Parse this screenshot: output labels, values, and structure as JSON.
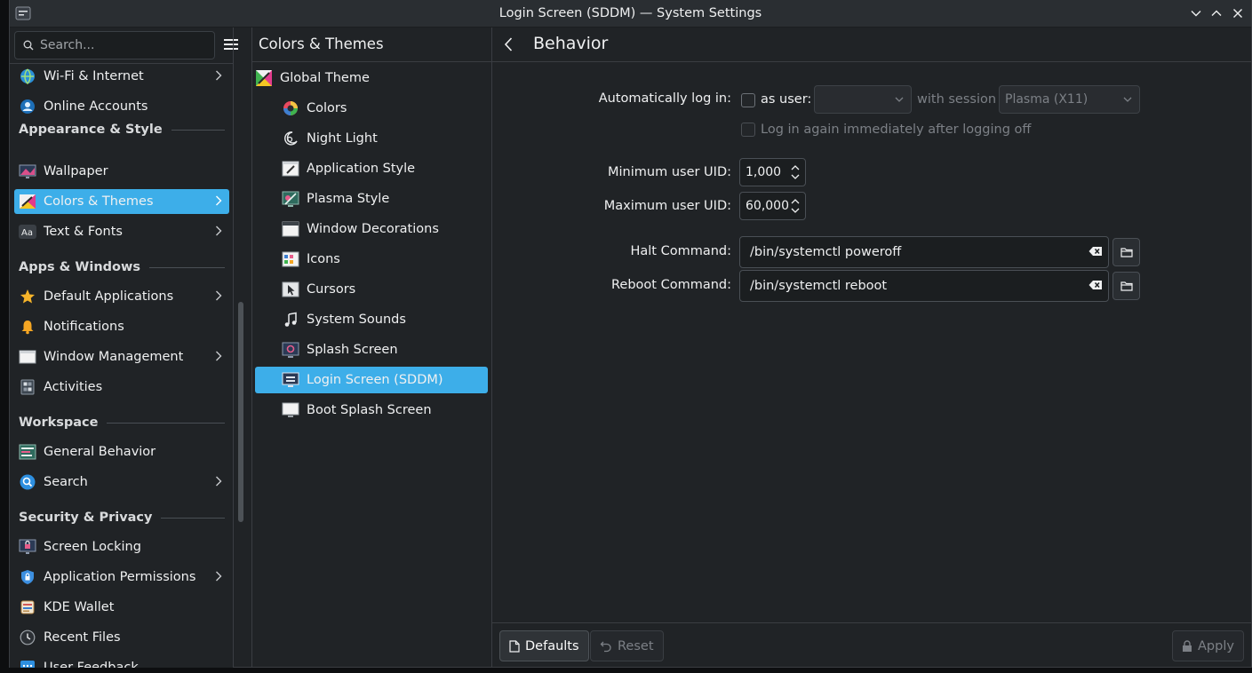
{
  "window": {
    "title": "Login Screen (SDDM) — System Settings"
  },
  "sidebar": {
    "search_placeholder": "Search...",
    "items": [
      {
        "label": "Wi-Fi & Internet",
        "icon": "wifi-globe-icon"
      },
      {
        "label": "Online Accounts",
        "icon": "online-accounts-icon"
      },
      {
        "heading": "Appearance & Style"
      },
      {
        "label": "Wallpaper",
        "icon": "wallpaper-icon"
      },
      {
        "label": "Colors & Themes",
        "icon": "colors-themes-icon",
        "selected": true
      },
      {
        "label": "Text & Fonts",
        "icon": "fonts-icon"
      },
      {
        "heading": "Apps & Windows"
      },
      {
        "label": "Default Applications",
        "icon": "star-icon"
      },
      {
        "label": "Notifications",
        "icon": "bell-icon"
      },
      {
        "label": "Window Management",
        "icon": "window-icon"
      },
      {
        "label": "Activities",
        "icon": "activities-icon"
      },
      {
        "heading": "Workspace"
      },
      {
        "label": "General Behavior",
        "icon": "general-behavior-icon"
      },
      {
        "label": "Search",
        "icon": "search-icon"
      },
      {
        "heading": "Security & Privacy"
      },
      {
        "label": "Screen Locking",
        "icon": "screen-lock-icon"
      },
      {
        "label": "Application Permissions",
        "icon": "shield-icon"
      },
      {
        "label": "KDE Wallet",
        "icon": "wallet-icon"
      },
      {
        "label": "Recent Files",
        "icon": "clock-icon"
      },
      {
        "label": "User Feedback",
        "icon": "feedback-icon"
      }
    ]
  },
  "middle": {
    "title": "Colors & Themes",
    "items": [
      {
        "label": "Global Theme"
      },
      {
        "label": "Colors"
      },
      {
        "label": "Night Light"
      },
      {
        "label": "Application Style"
      },
      {
        "label": "Plasma Style"
      },
      {
        "label": "Window Decorations"
      },
      {
        "label": "Icons"
      },
      {
        "label": "Cursors"
      },
      {
        "label": "System Sounds"
      },
      {
        "label": "Splash Screen"
      },
      {
        "label": "Login Screen (SDDM)",
        "selected": true
      },
      {
        "label": "Boot Splash Screen"
      }
    ]
  },
  "page": {
    "title": "Behavior",
    "autologin_label": "Automatically log in:",
    "as_user_label": "as user:",
    "user_value": "",
    "with_session_label": "with session",
    "session_value": "Plasma (X11)",
    "relogin_label": "Log in again immediately after logging off",
    "min_uid_label": "Minimum user UID:",
    "min_uid_value": "1,000",
    "max_uid_label": "Maximum user UID:",
    "max_uid_value": "60,000",
    "halt_label": "Halt Command:",
    "halt_value": "/bin/systemctl poweroff",
    "reboot_label": "Reboot Command:",
    "reboot_value": "/bin/systemctl reboot"
  },
  "footer": {
    "defaults_label": "Defaults",
    "reset_label": "Reset",
    "apply_label": "Apply"
  },
  "colors": {
    "accent": "#3daee9",
    "window_bg": "#202326"
  }
}
